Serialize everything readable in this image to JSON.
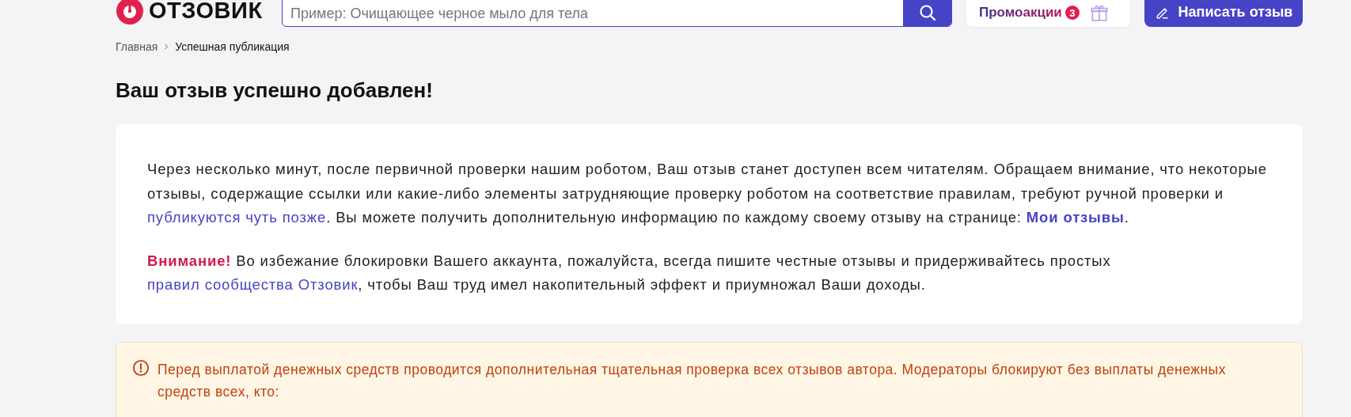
{
  "header": {
    "logo_text": "ОТЗОВИК",
    "search": {
      "placeholder": "Пример: Очищающее черное мыло для тела"
    },
    "promo": {
      "label": "Промоакции",
      "count": "3"
    },
    "write_button": "Написать отзыв"
  },
  "breadcrumbs": [
    "Главная",
    "Успешная публикация"
  ],
  "title": "Ваш отзыв успешно добавлен!",
  "paragraphs": [
    {
      "segments": [
        {
          "kind": "text",
          "text": "Через несколько минут, после первичной проверки нашим роботом, Ваш отзыв станет доступен всем читателям. Обращаем внимание, что некоторые отзывы, содержащие ссылки или какие-либо элементы затрудняющие проверку роботом на соответствие правилам, требуют ручной проверки и "
        },
        {
          "kind": "link",
          "text": "публикуются чуть позже"
        },
        {
          "kind": "text",
          "text": ". Вы можете получить дополнительную информацию по каждому своему отзыву на странице: "
        },
        {
          "kind": "strong-link",
          "text": "Мои отзывы"
        },
        {
          "kind": "text",
          "text": "."
        }
      ]
    },
    {
      "segments": [
        {
          "kind": "alert",
          "text": "Внимание!"
        },
        {
          "kind": "text",
          "text": " Во избежание блокировки Вашего аккаунта, пожалуйста, всегда пишите честные отзывы и придерживайтесь простых "
        },
        {
          "kind": "link",
          "text": "правил сообщества Отзовик"
        },
        {
          "kind": "text",
          "text": ", чтобы Ваш труд имел накопительный эффект и приумножал Ваши доходы."
        }
      ]
    }
  ],
  "notice": {
    "text": "Перед выплатой денежных средств проводится дополнительная тщательная проверка всех отзывов автора. Модераторы блокируют без выплаты денежных средств всех, кто:"
  }
}
